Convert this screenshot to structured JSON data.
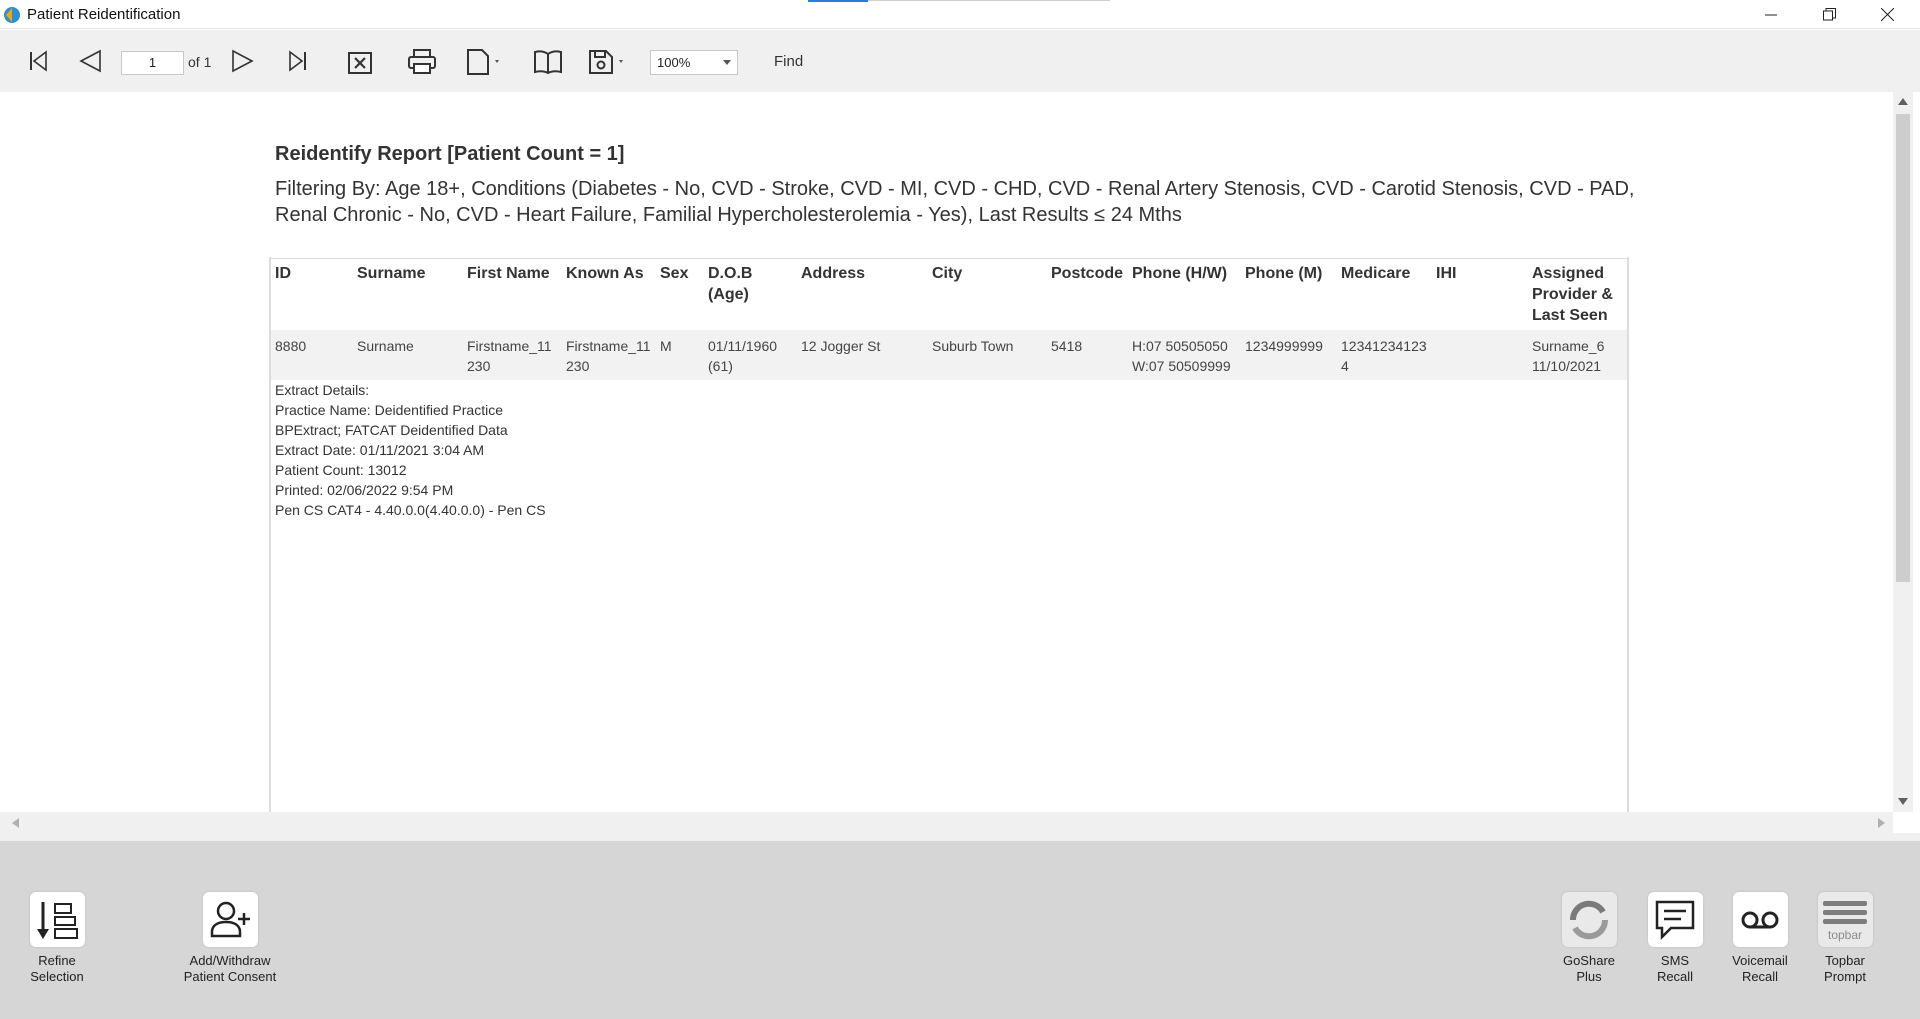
{
  "window": {
    "title": "Patient Reidentification"
  },
  "toolbar": {
    "page_value": "1",
    "page_of": "of 1",
    "zoom": "100%",
    "find_label": "Find"
  },
  "report": {
    "title": "Reidentify Report  [Patient Count = 1]",
    "filter": "Filtering By: Age 18+, Conditions (Diabetes - No, CVD - Stroke, CVD - MI, CVD - CHD, CVD - Renal Artery Stenosis, CVD - Carotid Stenosis, CVD - PAD, Renal Chronic - No, CVD - Heart Failure, Familial Hypercholesterolemia - Yes), Last Results ≤ 24 Mths",
    "columns": [
      "ID",
      "Surname",
      "First Name",
      "Known As",
      "Sex",
      "D.O.B (Age)",
      "Address",
      "City",
      "Postcode",
      "Phone (H/W)",
      "Phone (M)",
      "Medicare",
      "IHI",
      "Assigned Provider & Last Seen"
    ],
    "rows": [
      {
        "id": "8880",
        "surname": "Surname",
        "first_name": "Firstname_11230",
        "known_as": "Firstname_11230",
        "sex": "M",
        "dob": "01/11/1960 (61)",
        "address": "12 Jogger St",
        "city": "Suburb Town",
        "postcode": "5418",
        "phone_hw_h": "H:07 50505050",
        "phone_hw_w": "W:07 50509999",
        "phone_m": "1234999999",
        "medicare": "123412341234",
        "ihi": "",
        "provider": "Surname_6",
        "last_seen": "11/10/2021"
      }
    ],
    "extract_details": [
      "Extract Details:",
      "Practice Name: Deidentified Practice",
      "BPExtract; FATCAT Deidentified Data",
      "Extract Date: 01/11/2021 3:04 AM",
      "Patient Count: 13012",
      "Printed: 02/06/2022 9:54 PM",
      "Pen CS CAT4 - 4.40.0.0(4.40.0.0) - Pen CS"
    ]
  },
  "actions": {
    "refine": "Refine Selection",
    "consent": "Add/Withdraw Patient Consent",
    "goshare": "GoShare Plus",
    "sms": "SMS Recall",
    "voicemail": "Voicemail Recall",
    "topbar": "Topbar Prompt",
    "topbar_icon_text": "topbar"
  }
}
